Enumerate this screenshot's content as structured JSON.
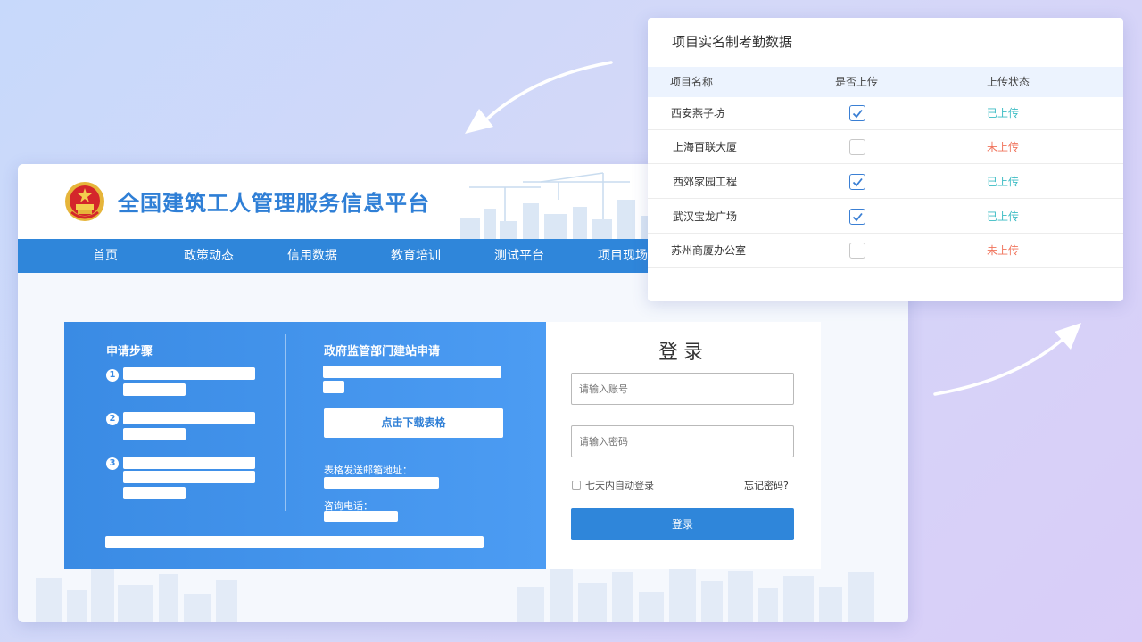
{
  "site": {
    "title": "全国建筑工人管理服务信息平台"
  },
  "nav": {
    "items": [
      {
        "label": "首页"
      },
      {
        "label": "政策动态"
      },
      {
        "label": "信用数据"
      },
      {
        "label": "教育培训"
      },
      {
        "label": "测试平台"
      },
      {
        "label": "项目现场"
      }
    ]
  },
  "steps": {
    "heading": "申请步骤",
    "numbers": [
      "1",
      "2",
      "3"
    ]
  },
  "apply": {
    "heading": "政府监管部门建站申请",
    "download_label": "点击下载表格",
    "email_label": "表格发送邮箱地址：",
    "phone_label": "咨询电话："
  },
  "login": {
    "title": "登录",
    "account_placeholder": "请输入账号",
    "password_placeholder": "请输入密码",
    "remember_label": "七天内自动登录",
    "forgot_label": "忘记密码?",
    "submit_label": "登录"
  },
  "attendance": {
    "title": "项目实名制考勤数据",
    "columns": [
      "项目名称",
      "是否上传",
      "上传状态"
    ],
    "rows": [
      {
        "name": "西安燕子坊",
        "uploaded": true,
        "status": "已上传"
      },
      {
        "name": "上海百联大厦",
        "uploaded": false,
        "status": "未上传"
      },
      {
        "name": "西郊家园工程",
        "uploaded": true,
        "status": "已上传"
      },
      {
        "name": "武汉宝龙广场",
        "uploaded": true,
        "status": "已上传"
      },
      {
        "name": "苏州商厦办公室",
        "uploaded": false,
        "status": "未上传"
      }
    ]
  },
  "colors": {
    "brand_blue": "#2f86da",
    "uploaded": "#3cbcc4",
    "not_uploaded": "#f0745c"
  }
}
